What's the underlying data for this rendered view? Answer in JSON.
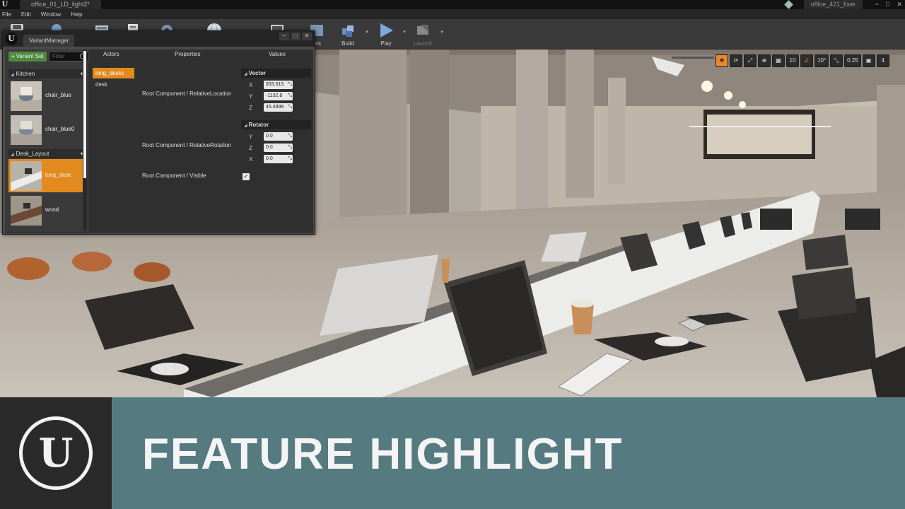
{
  "titlebar": {
    "document_tab": "office_01_LD_light2*",
    "project_name": "office_421_fixer",
    "controls": [
      "−",
      "□",
      "✕"
    ]
  },
  "menu": [
    "File",
    "Edit",
    "Window",
    "Help"
  ],
  "toolbar": {
    "items": [
      {
        "label": "",
        "icon": "save-icon"
      },
      {
        "label": "",
        "icon": "source-control-icon"
      },
      {
        "label": "",
        "icon": "content-icon"
      },
      {
        "label": "",
        "icon": "settings-icon"
      },
      {
        "label": "",
        "icon": "world-icon"
      },
      {
        "label": "",
        "icon": "cinematics-icon"
      },
      {
        "label": "tics",
        "icon": "blueprint-icon"
      },
      {
        "label": "Build",
        "icon": "build-icon"
      },
      {
        "label": "Play",
        "icon": "play-icon"
      },
      {
        "label": "Launch",
        "icon": "launch-icon"
      }
    ]
  },
  "viewport_tools": [
    "✥",
    "⟳",
    "⤢",
    "⊕",
    "▦",
    "10",
    "∠",
    "10°",
    "⤡",
    "0.25",
    "▣",
    "4"
  ],
  "variant_manager": {
    "tab_title": "VariantManager",
    "add_variant_set_label": "Variant Set",
    "filter_placeholder": "Filter",
    "columns": {
      "actors": "Actors",
      "properties": "Properties",
      "values": "Values"
    },
    "variant_sets": [
      {
        "name": "Kitchen",
        "variants": [
          {
            "name": "chair_blue",
            "selected": false
          },
          {
            "name": "chair_blue0",
            "selected": false
          }
        ]
      },
      {
        "name": "Desk_Layout",
        "variants": [
          {
            "name": "long_desk",
            "selected": true
          },
          {
            "name": "wood",
            "selected": false
          }
        ]
      }
    ],
    "actors": [
      {
        "name": "long_desks",
        "selected": true
      },
      {
        "name": "desk",
        "selected": false
      }
    ],
    "properties": [
      {
        "label": "Root Component  /  RelativeLocation",
        "group": "Vector",
        "fields": [
          {
            "axis": "X",
            "value": "833.615"
          },
          {
            "axis": "Y",
            "value": "-1132.8"
          },
          {
            "axis": "Z",
            "value": "45.4999"
          }
        ]
      },
      {
        "label": "Root Component  /  RelativeRotation",
        "group": "Rotator",
        "fields": [
          {
            "axis": "Y",
            "value": "0.0"
          },
          {
            "axis": "Z",
            "value": "0.0"
          },
          {
            "axis": "X",
            "value": "0.0"
          }
        ]
      },
      {
        "label": "Root Component  /  Visible",
        "checked": true
      }
    ]
  },
  "banner": {
    "title": "FEATURE HIGHLIGHT",
    "background": "#557a80",
    "logo_background": "#2a2a2a"
  },
  "colors": {
    "selection_orange": "#e38a1e",
    "add_green": "#4f8a3f"
  }
}
